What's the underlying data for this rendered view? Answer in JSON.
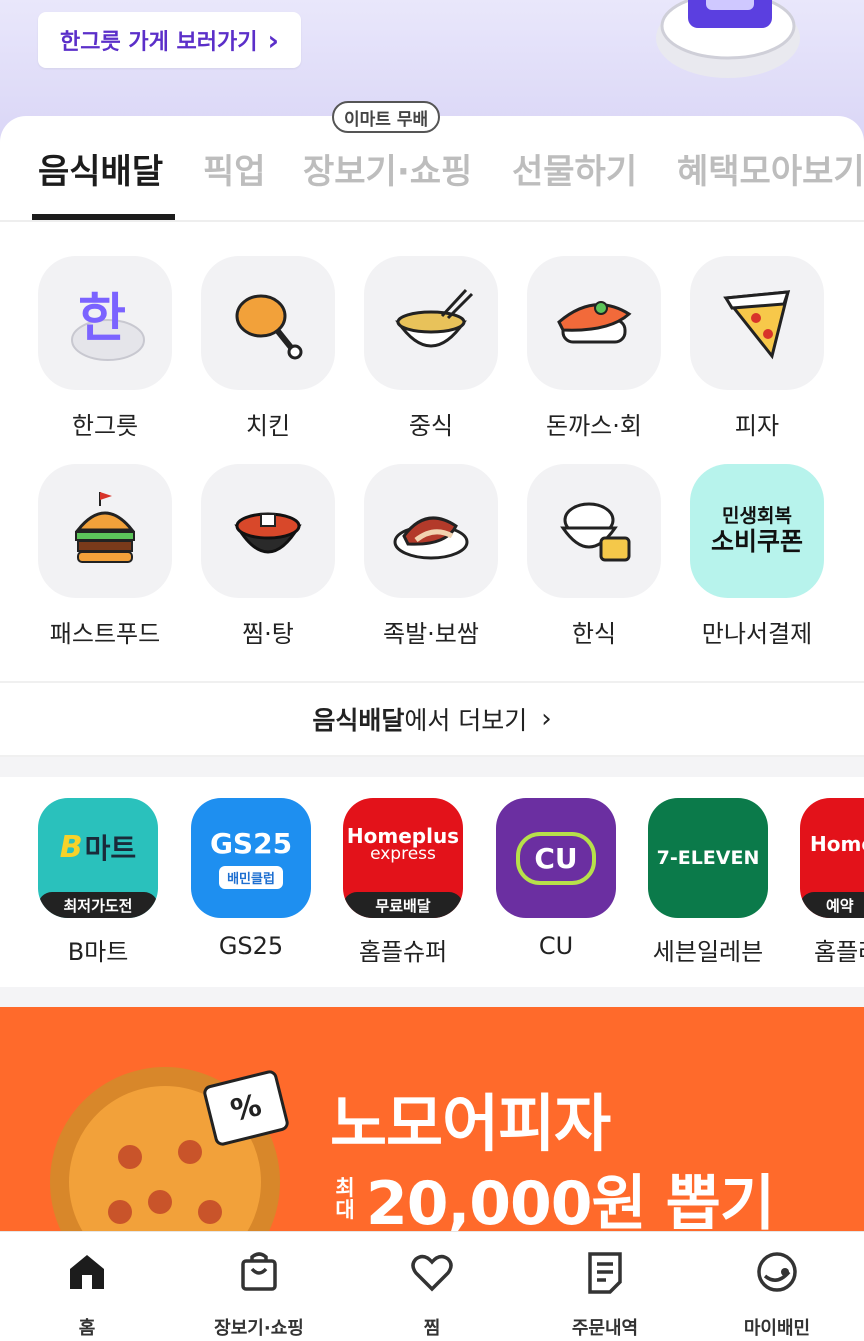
{
  "hero": {
    "button_label": "한그릇 가게 보러가기",
    "chevron": "›"
  },
  "badge": "이마트 무배",
  "tabs": [
    {
      "label": "음식배달",
      "active": true
    },
    {
      "label": "픽업",
      "active": false
    },
    {
      "label": "장보기·쇼핑",
      "active": false
    },
    {
      "label": "선물하기",
      "active": false
    },
    {
      "label": "혜택모아보기",
      "active": false
    }
  ],
  "categories": [
    {
      "label": "한그릇",
      "icon": "hangeureut-bowl-icon",
      "tile_text": "한"
    },
    {
      "label": "치킨",
      "icon": "chicken-drumstick-icon"
    },
    {
      "label": "중식",
      "icon": "noodle-bowl-icon"
    },
    {
      "label": "돈까스·회",
      "icon": "sushi-icon"
    },
    {
      "label": "피자",
      "icon": "pizza-slice-icon"
    },
    {
      "label": "패스트푸드",
      "icon": "burger-icon"
    },
    {
      "label": "찜·탕",
      "icon": "stew-pot-icon"
    },
    {
      "label": "족발·보쌈",
      "icon": "jokbal-icon"
    },
    {
      "label": "한식",
      "icon": "rice-bowl-icon"
    },
    {
      "label": "만나서결제",
      "icon": "coupon-banner",
      "tile_line1": "민생회복",
      "tile_line2": "소비쿠폰"
    }
  ],
  "more": {
    "bold": "음식배달",
    "rest": "에서 더보기",
    "chevron": "›"
  },
  "stores": [
    {
      "label": "B마트",
      "logo_text": "마트",
      "logo_mark": "B",
      "strip": "최저가도전",
      "color": "#2ac1bc"
    },
    {
      "label": "GS25",
      "logo_text": "GS25",
      "strip": "배민클럽",
      "color": "#1e8ff0"
    },
    {
      "label": "홈플슈퍼",
      "logo_text": "Homeplus",
      "logo_sub": "express",
      "strip": "무료배달",
      "color": "#e3121a"
    },
    {
      "label": "CU",
      "logo_text": "CU",
      "color": "#6b2fa1"
    },
    {
      "label": "세븐일레븐",
      "logo_text": "7-ELEVEN",
      "color": "#0b7a4a"
    },
    {
      "label": "홈플러",
      "logo_text": "Home",
      "strip": "예약",
      "color": "#e3121a"
    }
  ],
  "banner": {
    "title": "노모어피자",
    "sub_small_1": "최",
    "sub_small_2": "대",
    "sub_big": "20,000원 뽑기",
    "coupon_symbol": "%"
  },
  "bottom_nav": [
    {
      "label": "홈",
      "icon": "home-icon"
    },
    {
      "label": "장보기·쇼핑",
      "icon": "shopping-bag-icon"
    },
    {
      "label": "찜",
      "icon": "heart-icon"
    },
    {
      "label": "주문내역",
      "icon": "order-list-icon"
    },
    {
      "label": "마이배민",
      "icon": "my-baemin-icon"
    }
  ]
}
